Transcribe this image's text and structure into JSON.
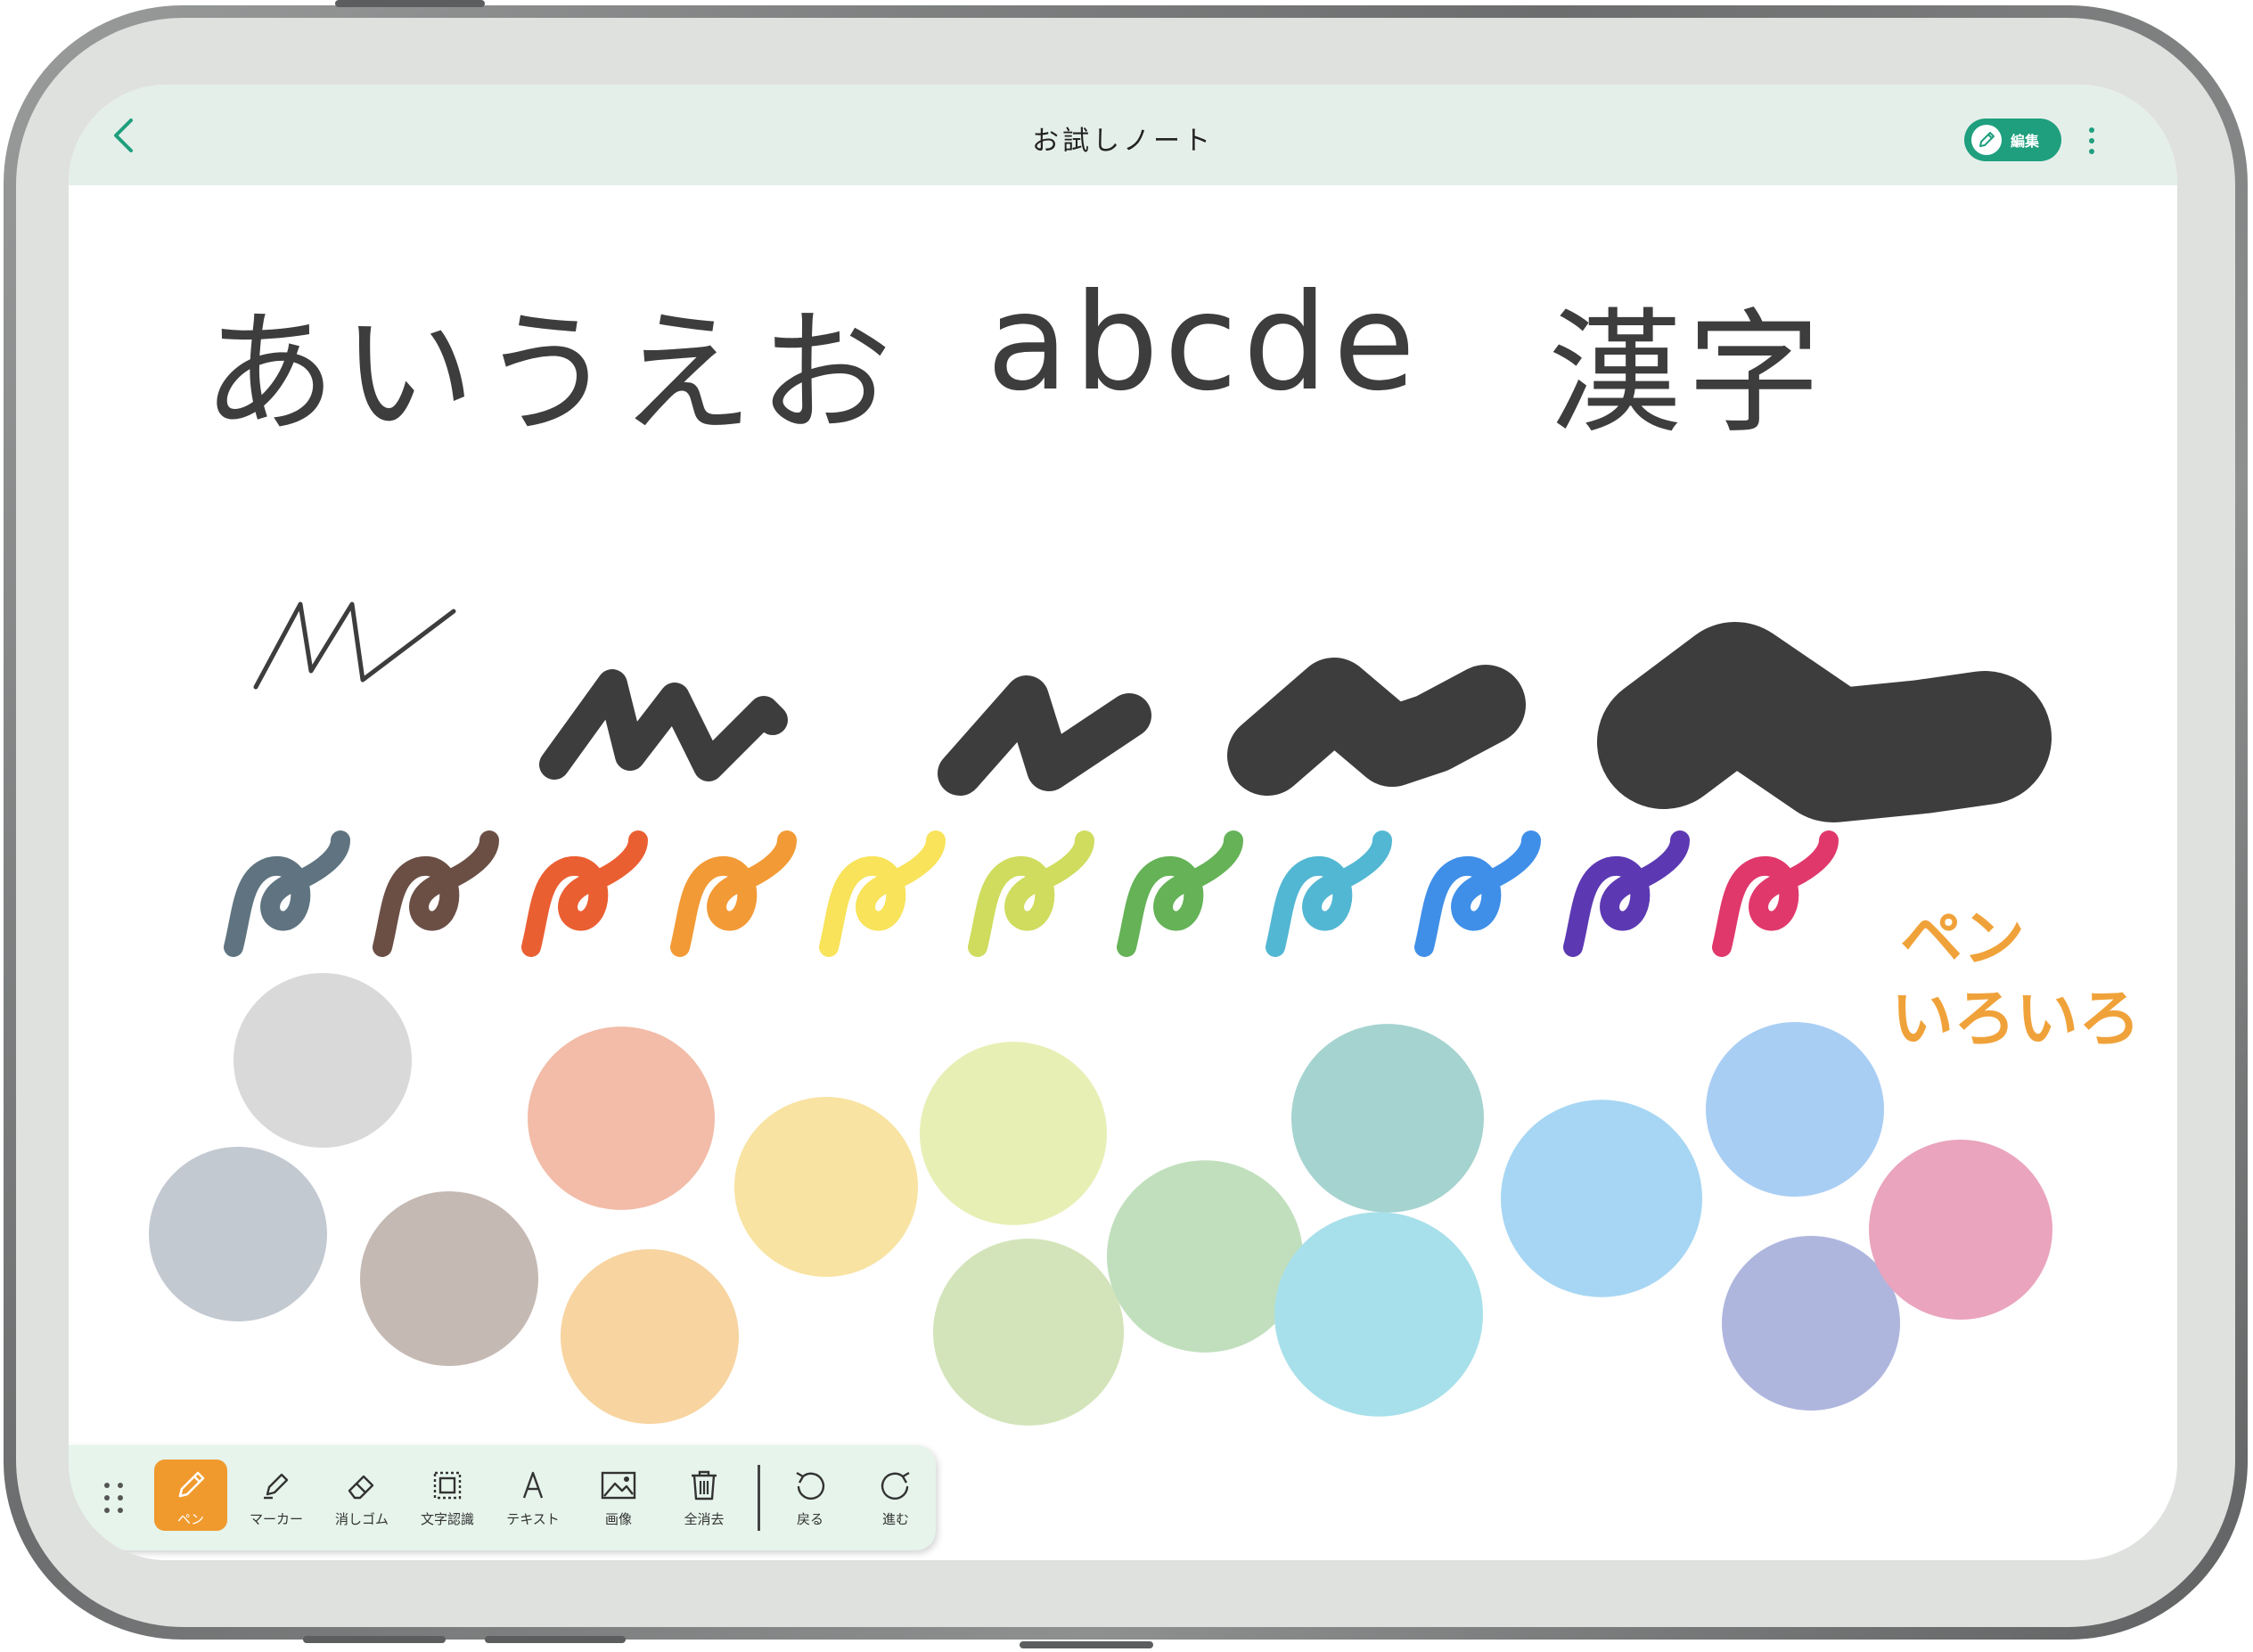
{
  "header": {
    "title": "お試しノート",
    "edit_label": "編集",
    "back_icon": "chevron-left-icon",
    "more_icon": "more-vertical-icon"
  },
  "canvas": {
    "handwriting": {
      "hiragana": "あいうえお",
      "latin": "abcde",
      "kanji": "漢字"
    },
    "color_note_line1": "ペン",
    "color_note_line2": "いろいろ"
  },
  "colors": {
    "accent": "#1f9f7e",
    "header_bg": "#e5efea",
    "toolbar_bg": "#e6f4ec",
    "active_tool": "#f09a2e",
    "ink": "#3d3d3d",
    "pen_colors": [
      "#5f7480",
      "#6b4f45",
      "#ea5f32",
      "#f29a36",
      "#f8e35a",
      "#cfdc5e",
      "#65b257",
      "#52b7d3",
      "#3f8fe8",
      "#5c39b2",
      "#e0386b"
    ],
    "marker_colors": [
      "#d9d9d9",
      "#c3c9d1",
      "#c5b9b3",
      "#f2bca8",
      "#f7d4a0",
      "#f8e3a2",
      "#e8efb5",
      "#d4e4ba",
      "#c1dfbd",
      "#a5d3d0",
      "#a7e0ea",
      "#a6d6f3",
      "#a9cef4",
      "#afb6de",
      "#eaa4bd"
    ]
  },
  "toolbar": {
    "tools": [
      {
        "label": "ペン",
        "icon": "pen-icon"
      },
      {
        "label": "マーカー",
        "icon": "marker-icon"
      },
      {
        "label": "消しゴム",
        "icon": "eraser-icon"
      },
      {
        "label": "文字認識",
        "icon": "text-recognition-icon"
      },
      {
        "label": "テキスト",
        "icon": "text-icon"
      },
      {
        "label": "画像",
        "icon": "image-icon"
      },
      {
        "label": "全消去",
        "icon": "trash-icon"
      }
    ],
    "undo_label": "戻る",
    "redo_label": "進む",
    "grip_icon": "grip-icon"
  }
}
